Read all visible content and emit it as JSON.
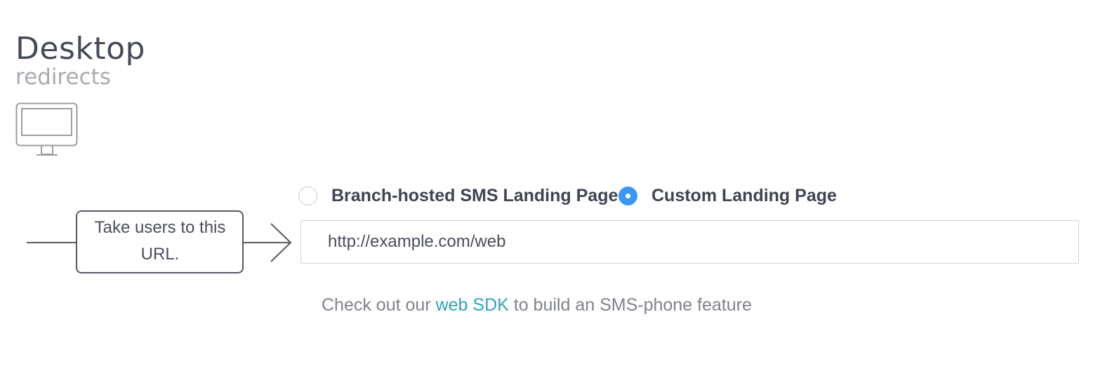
{
  "section": {
    "title": "Desktop",
    "subtitle": "redirects",
    "icon": "desktop-monitor-icon"
  },
  "callout": {
    "text": "Take users to this URL."
  },
  "redirect_options": [
    {
      "label": "Branch-hosted SMS Landing Page",
      "selected": false
    },
    {
      "label": "Custom Landing Page",
      "selected": true
    }
  ],
  "url_field": {
    "value": "http://example.com/web"
  },
  "helper": {
    "prefix": "Check out our ",
    "link_text": "web SDK",
    "suffix": " to build an SMS-phone feature"
  },
  "colors": {
    "accent": "#3d97f0",
    "link": "#2fa3bb",
    "title": "#454a57",
    "muted": "#a9abb0"
  }
}
